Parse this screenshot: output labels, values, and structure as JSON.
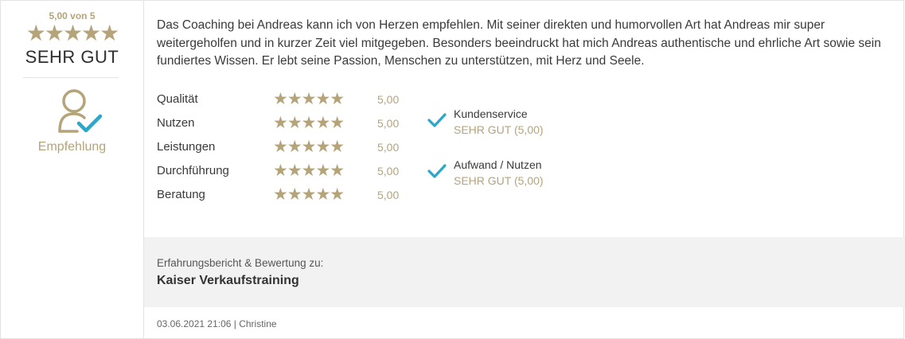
{
  "summary": {
    "score_label": "5,00 von 5",
    "stars": "★★★★★",
    "verdict": "SEHR GUT",
    "recommendation_label": "Empfehlung"
  },
  "review": {
    "text": "Das Coaching bei Andreas kann ich von Herzen empfehlen. Mit seiner direkten und humorvollen Art hat Andreas mir super weitergeholfen und in kurzer Zeit viel mitgegeben. Besonders beeindruckt hat mich Andreas authentische und ehrliche Art sowie sein fundiertes Wissen. Er lebt seine Passion, Menschen zu unterstützen, mit Herz und Seele."
  },
  "ratings": [
    {
      "label": "Qualität",
      "stars": "★★★★★",
      "value": "5,00"
    },
    {
      "label": "Nutzen",
      "stars": "★★★★★",
      "value": "5,00"
    },
    {
      "label": "Leistungen",
      "stars": "★★★★★",
      "value": "5,00"
    },
    {
      "label": "Durchführung",
      "stars": "★★★★★",
      "value": "5,00"
    },
    {
      "label": "Beratung",
      "stars": "★★★★★",
      "value": "5,00"
    }
  ],
  "criteria": [
    {
      "title": "Kundenservice",
      "value": "SEHR GUT (5,00)"
    },
    {
      "title": "Aufwand / Nutzen",
      "value": "SEHR GUT (5,00)"
    }
  ],
  "footer": {
    "about_label": "Erfahrungsbericht & Bewertung zu:",
    "company": "Kaiser Verkaufstraining",
    "meta": "03.06.2021 21:06 | Christine"
  },
  "colors": {
    "gold": "#b5a47a",
    "check": "#2aa7c9",
    "border": "#e3e3e3",
    "footer_bg": "#f2f2f2"
  },
  "icons": {
    "recommendation": "person-check-icon",
    "criteria_check": "checkmark-icon"
  }
}
